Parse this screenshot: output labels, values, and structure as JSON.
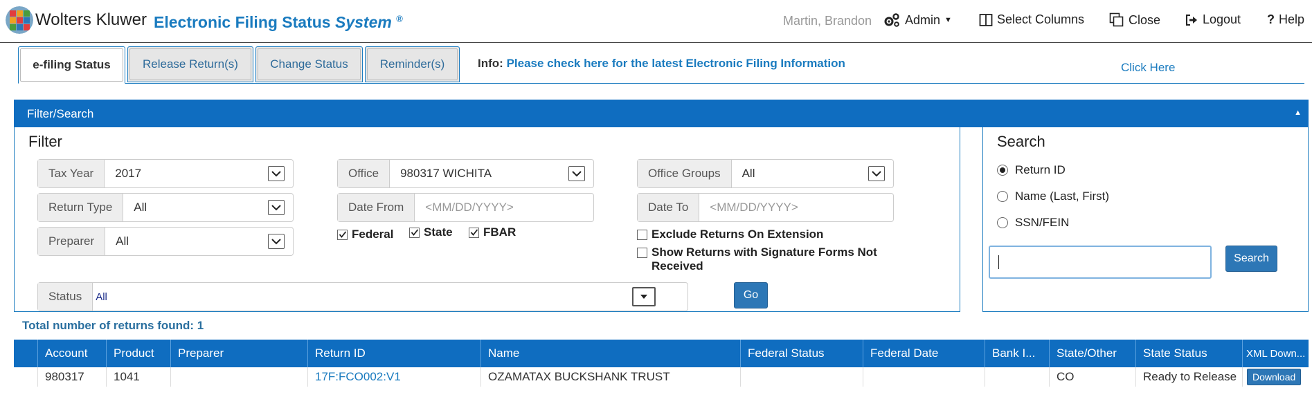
{
  "header": {
    "logo_text": "Wolters Kluwer",
    "app_title_main": "Electronic Filing Status",
    "app_title_italic": "System",
    "app_title_mark": "®",
    "user": "Martin, Brandon",
    "admin": "Admin",
    "select_columns": "Select Columns",
    "close": "Close",
    "logout": "Logout",
    "help": "Help"
  },
  "tabs": [
    {
      "label": "e-filing Status"
    },
    {
      "label": "Release Return(s)"
    },
    {
      "label": "Change Status"
    },
    {
      "label": "Reminder(s)"
    }
  ],
  "info": {
    "prefix": "Info:",
    "text": "Please check here for the latest Electronic Filing Information",
    "click_here": "Click Here"
  },
  "filter_search": {
    "bar_title": "Filter/Search",
    "toggle": "▲"
  },
  "filter": {
    "title": "Filter",
    "tax_year_label": "Tax Year",
    "tax_year_value": "2017",
    "return_type_label": "Return Type",
    "return_type_value": "All",
    "preparer_label": "Preparer",
    "preparer_value": "All",
    "office_label": "Office",
    "office_value": "980317 WICHITA",
    "date_from_label": "Date From",
    "date_from_placeholder": "<MM/DD/YYYY>",
    "office_groups_label": "Office Groups",
    "office_groups_value": "All",
    "date_to_label": "Date To",
    "date_to_placeholder": "<MM/DD/YYYY>",
    "federal": "Federal",
    "state": "State",
    "fbar": "FBAR",
    "exclude_ext": "Exclude Returns On Extension",
    "show_sig_line1": "Show Returns with Signature Forms Not",
    "show_sig_line2": "Received",
    "status_label": "Status",
    "status_value": "All",
    "go": "Go"
  },
  "search": {
    "title": "Search",
    "options": [
      "Return ID",
      "Name (Last, First)",
      "SSN/FEIN"
    ],
    "selected": "Return ID",
    "input_value": "",
    "button": "Search"
  },
  "results": {
    "total_text": "Total number of returns found: 1",
    "columns": [
      "Account",
      "Product",
      "Preparer",
      "Return ID",
      "Name",
      "Federal Status",
      "Federal Date",
      "Bank I...",
      "State/Other",
      "State Status",
      "XML Down..."
    ],
    "rows": [
      [
        "980317",
        "1041",
        "",
        "17F:FCO002:V1",
        "OZAMATAX BUCKSHANK TRUST",
        "",
        "",
        "",
        "CO",
        "Ready to Release",
        "Download"
      ]
    ]
  },
  "colors": {
    "brand_blue": "#0f6dc0",
    "link_blue": "#1a7bbf",
    "button_blue": "#2d77b6"
  }
}
